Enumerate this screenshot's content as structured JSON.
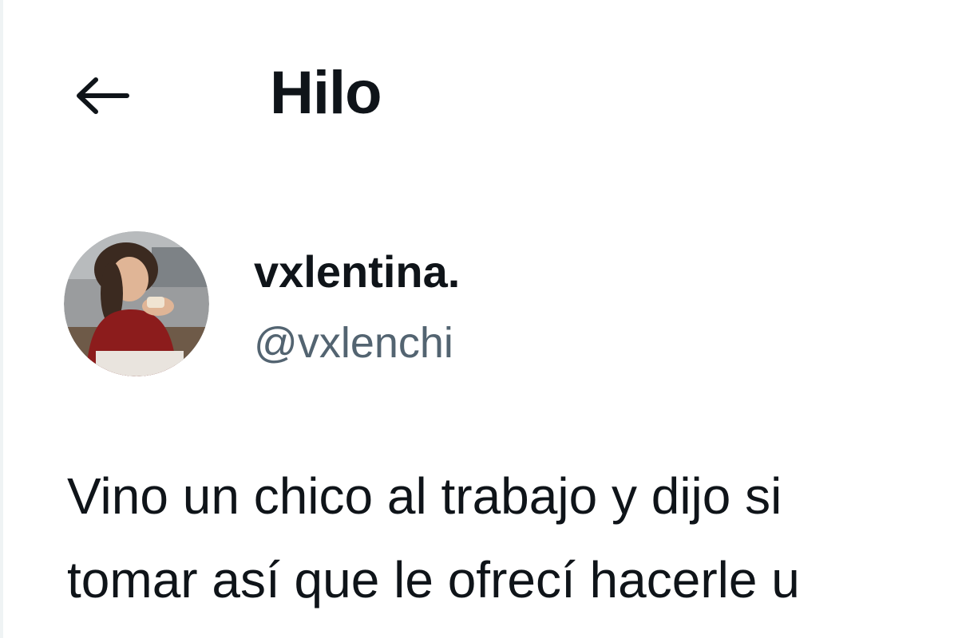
{
  "header": {
    "back_icon": "arrow-left-icon",
    "title": "Hilo"
  },
  "author": {
    "avatar_icon": "profile-photo",
    "display_name": "vxlentina.",
    "username": "@vxlenchi"
  },
  "tweet": {
    "lines": [
      "Vino un chico al trabajo y dijo si",
      "tomar así que le ofrecí hacerle u"
    ]
  },
  "colors": {
    "text_primary": "#0f1419",
    "text_secondary": "#536471",
    "background": "#ffffff"
  }
}
